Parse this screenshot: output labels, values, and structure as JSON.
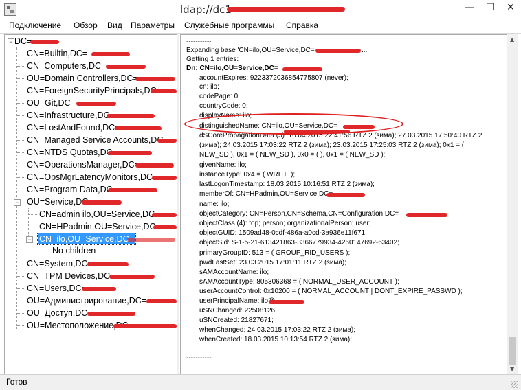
{
  "window": {
    "title": "ldap://dc1",
    "minimize": "—",
    "maximize": "☐",
    "close": "✕"
  },
  "menu": [
    "Подключение",
    "Обзор",
    "Вид",
    "Параметры",
    "Служебные программы",
    "Справка"
  ],
  "tree": {
    "root": "DC=",
    "children": [
      "CN=Builtin,DC=",
      "CN=Computers,DC=",
      "OU=Domain Controllers,DC=",
      "CN=ForeignSecurityPrincipals,DC=",
      "OU=Git,DC=",
      "CN=Infrastructure,DC=",
      "CN=LostAndFound,DC=",
      "CN=Managed Service Accounts,DC=",
      "CN=NTDS Quotas,DC=",
      "CN=OperationsManager,DC=",
      "CN=OpsMgrLatencyMonitors,DC=",
      "CN=Program Data,DC=",
      "OU=Service,DC="
    ],
    "service_children": [
      "CN=admin ilo,OU=Service,DC=",
      "CN=HPadmin,OU=Service,DC=",
      "CN=ilo,OU=Service,DC="
    ],
    "no_children": "No children",
    "after": [
      "CN=System,DC=",
      "CN=TPM Devices,DC=",
      "CN=Users,DC=",
      "OU=Администрирование,DC=",
      "OU=Доступ,DC=",
      "OU=Местоположение,DC="
    ]
  },
  "details": {
    "sep1": "-----------",
    "expanding": "Expanding base 'CN=ilo,OU=Service,DC=",
    "getting": "Getting 1 entries:",
    "dn": "Dn: CN=ilo,OU=Service,DC=",
    "attrs": [
      "accountExpires: 9223372036854775807 (never);",
      "cn: ilo;",
      "codePage: 0;",
      "countryCode: 0;",
      "displayName: ilo;",
      "distinguishedName: CN=ilo,OU=Service,DC=",
      "dSCorePropagationData (5): 16.04.2015 22:41:56 RTZ 2 (зима); 27.03.2015 17:50:40 RTZ 2",
      "(зима); 24.03.2015 17:03:22 RTZ 2 (зима); 23.03.2015 17:25:03 RTZ 2 (зима); 0x1 = (",
      "NEW_SD ), 0x1 = ( NEW_SD ), 0x0 = (  ), 0x1 = ( NEW_SD );",
      "givenName: ilo;",
      "instanceType: 0x4 = ( WRITE );",
      "lastLogonTimestamp: 18.03.2015 10:16:51 RTZ 2 (зима);",
      "memberOf: CN=HPadmin,OU=Service,DC=",
      "name: ilo;",
      "objectCategory: CN=Person,CN=Schema,CN=Configuration,DC=",
      "objectClass (4): top; person; organizationalPerson; user;",
      "objectGUID: 1509ad48-0cdf-486a-a0cd-3a936e11f671;",
      "objectSid: S-1-5-21-613421863-3366779934-4260147692-63402;",
      "primaryGroupID: 513 = ( GROUP_RID_USERS );",
      "pwdLastSet: 23.03.2015 17:01:11 RTZ 2 (зима);",
      "sAMAccountName: ilo;",
      "sAMAccountType: 805306368 = ( NORMAL_USER_ACCOUNT );",
      "userAccountControl: 0x10200 = ( NORMAL_ACCOUNT | DONT_EXPIRE_PASSWD );",
      "userPrincipalName: ilo@",
      "uSNChanged: 22508126;",
      "uSNCreated: 21827671;",
      "whenChanged: 24.03.2015 17:03:22 RTZ 2 (зима);",
      "whenCreated: 18.03.2015 10:13:54 RTZ 2 (зима);"
    ],
    "sep2": "-----------"
  },
  "status": "Готов"
}
